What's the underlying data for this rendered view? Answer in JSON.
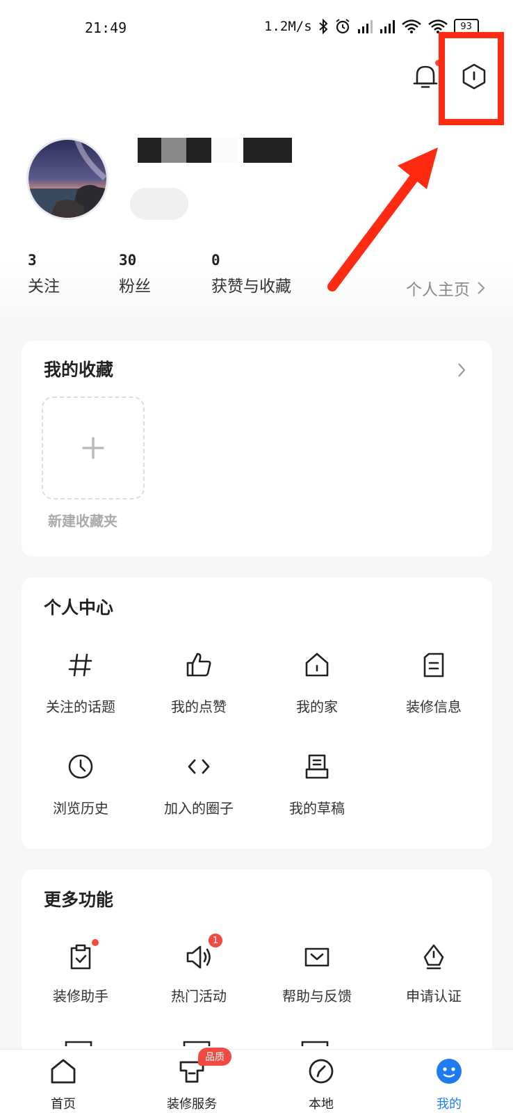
{
  "status_bar": {
    "time": "21:49",
    "net_speed": "1.2M/s",
    "battery": "93"
  },
  "profile": {
    "stats": [
      {
        "num": "3",
        "label": "关注"
      },
      {
        "num": "30",
        "label": "粉丝"
      },
      {
        "num": "0",
        "label": "获赞与收藏"
      }
    ],
    "homepage_label": "个人主页"
  },
  "favorites": {
    "title": "我的收藏",
    "new_folder_label": "新建收藏夹"
  },
  "personal_center": {
    "title": "个人中心",
    "items": [
      {
        "label": "关注的话题",
        "icon": "hashtag-icon"
      },
      {
        "label": "我的点赞",
        "icon": "thumbs-up-icon"
      },
      {
        "label": "我的家",
        "icon": "house-icon"
      },
      {
        "label": "装修信息",
        "icon": "document-icon"
      },
      {
        "label": "浏览历史",
        "icon": "clock-icon"
      },
      {
        "label": "加入的圈子",
        "icon": "code-brackets-icon"
      },
      {
        "label": "我的草稿",
        "icon": "draft-icon"
      }
    ]
  },
  "more_functions": {
    "title": "更多功能",
    "items": [
      {
        "label": "装修助手",
        "icon": "clipboard-check-icon"
      },
      {
        "label": "热门活动",
        "icon": "speaker-icon",
        "badge": "1"
      },
      {
        "label": "帮助与反馈",
        "icon": "mail-icon"
      },
      {
        "label": "申请认证",
        "icon": "pen-nib-icon"
      }
    ]
  },
  "bottom_nav": {
    "items": [
      {
        "label": "首页",
        "icon": "home-icon"
      },
      {
        "label": "装修服务",
        "icon": "service-icon",
        "badge": "品质"
      },
      {
        "label": "本地",
        "icon": "location-icon"
      },
      {
        "label": "我的",
        "icon": "profile-icon",
        "active": true
      }
    ]
  },
  "colors": {
    "accent_red": "#f04a41",
    "highlight_red": "#ff2a12",
    "active_blue": "#1e7cf0"
  }
}
